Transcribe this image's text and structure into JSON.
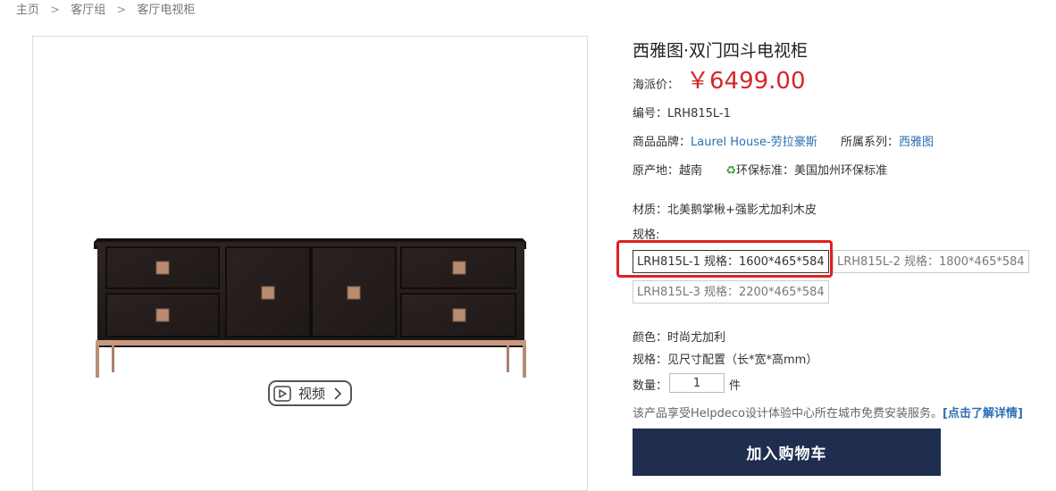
{
  "breadcrumb": {
    "items": [
      "主页",
      "客厅组",
      "客厅电视柜"
    ],
    "separator": ">"
  },
  "gallery": {
    "video_label": "视频"
  },
  "product": {
    "title": "西雅图·双门四斗电视柜",
    "price_label": "海派价：",
    "price": "￥6499.00",
    "code_label": "编号：",
    "code": "LRH815L-1",
    "brand_label": "商品品牌：",
    "brand": "Laurel House-劳拉豪斯",
    "series_label": "所属系列：",
    "series": "西雅图",
    "origin_label": "原产地：",
    "origin": "越南",
    "eco_label": "环保标准：",
    "eco": "美国加州环保标准",
    "material_label": "材质：",
    "material": "北美鹅掌楸+强影尤加利木皮",
    "spec_label": "规格:",
    "spec_options": [
      "LRH815L-1 规格：1600*465*584",
      "LRH815L-2 规格：1800*465*584",
      "LRH815L-3 规格：2200*465*584"
    ],
    "color_label": "颜色：",
    "color": "时尚尤加利",
    "size_label": "规格：",
    "size": "见尺寸配置（长*宽*高mm）",
    "qty_label": "数量：",
    "qty_value": "1",
    "qty_unit": "件",
    "install_text": "该产品享受Helpdeco设计体验中心所在城市免费安装服务。",
    "install_link": "[点击了解详情]",
    "add_to_cart": "加入购物车"
  },
  "colors": {
    "price": "#d6252b",
    "link": "#2a6fb3",
    "cart_button": "#1f2d4f",
    "highlight": "#e02020",
    "eco_icon": "#3a9b3a"
  },
  "icons": [
    "recycle-icon",
    "play-icon",
    "chevron-right-icon"
  ]
}
